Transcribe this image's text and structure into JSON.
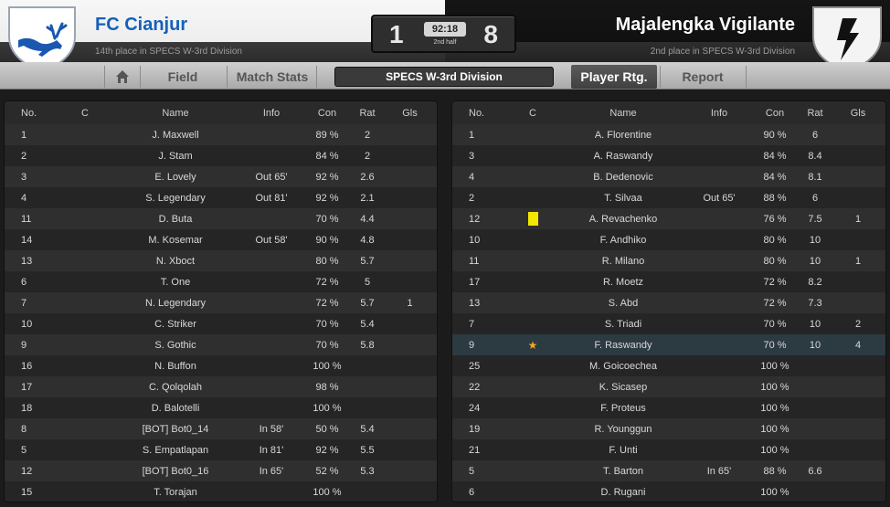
{
  "header": {
    "home": {
      "name": "FC Cianjur",
      "subtitle": "14th place in SPECS W-3rd Division",
      "score": "1"
    },
    "away": {
      "name": "Majalengka Vigilante",
      "subtitle": "2nd place in SPECS W-3rd Division",
      "score": "8"
    },
    "clock": "92:18",
    "half": "2nd half"
  },
  "nav": {
    "home_icon": "home-icon",
    "field": "Field",
    "match_stats": "Match Stats",
    "division": "SPECS W-3rd Division",
    "player_rtg": "Player Rtg.",
    "report": "Report"
  },
  "columns": [
    "No.",
    "C",
    "Name",
    "Info",
    "Con",
    "Rat",
    "Gls"
  ],
  "colors": {
    "home_accent": "#1560b8",
    "yellow_card": "#f3e600",
    "star": "#f5a623"
  },
  "home_players": [
    {
      "no": "1",
      "c": "",
      "name": "J. Maxwell",
      "info": "",
      "con": "89 %",
      "rat": "2",
      "gls": ""
    },
    {
      "no": "2",
      "c": "",
      "name": "J. Stam",
      "info": "",
      "con": "84 %",
      "rat": "2",
      "gls": ""
    },
    {
      "no": "3",
      "c": "",
      "name": "E. Lovely",
      "info": "Out 65'",
      "con": "92 %",
      "rat": "2.6",
      "gls": ""
    },
    {
      "no": "4",
      "c": "",
      "name": "S. Legendary",
      "info": "Out 81'",
      "con": "92 %",
      "rat": "2.1",
      "gls": ""
    },
    {
      "no": "11",
      "c": "",
      "name": "D. Buta",
      "info": "",
      "con": "70 %",
      "rat": "4.4",
      "gls": ""
    },
    {
      "no": "14",
      "c": "",
      "name": "M. Kosemar",
      "info": "Out 58'",
      "con": "90 %",
      "rat": "4.8",
      "gls": ""
    },
    {
      "no": "13",
      "c": "",
      "name": "N. Xboct",
      "info": "",
      "con": "80 %",
      "rat": "5.7",
      "gls": ""
    },
    {
      "no": "6",
      "c": "",
      "name": "T. One",
      "info": "",
      "con": "72 %",
      "rat": "5",
      "gls": ""
    },
    {
      "no": "7",
      "c": "",
      "name": "N. Legendary",
      "info": "",
      "con": "72 %",
      "rat": "5.7",
      "gls": "1"
    },
    {
      "no": "10",
      "c": "",
      "name": "C. Striker",
      "info": "",
      "con": "70 %",
      "rat": "5.4",
      "gls": ""
    },
    {
      "no": "9",
      "c": "",
      "name": "S. Gothic",
      "info": "",
      "con": "70 %",
      "rat": "5.8",
      "gls": ""
    },
    {
      "no": "16",
      "c": "",
      "name": "N. Buffon",
      "info": "",
      "con": "100 %",
      "rat": "",
      "gls": ""
    },
    {
      "no": "17",
      "c": "",
      "name": "C. Qolqolah",
      "info": "",
      "con": "98 %",
      "rat": "",
      "gls": ""
    },
    {
      "no": "18",
      "c": "",
      "name": "D. Balotelli",
      "info": "",
      "con": "100 %",
      "rat": "",
      "gls": ""
    },
    {
      "no": "8",
      "c": "",
      "name": "[BOT] Bot0_14",
      "info": "In 58'",
      "con": "50 %",
      "rat": "5.4",
      "gls": ""
    },
    {
      "no": "5",
      "c": "",
      "name": "S. Empatlapan",
      "info": "In 81'",
      "con": "92 %",
      "rat": "5.5",
      "gls": ""
    },
    {
      "no": "12",
      "c": "",
      "name": "[BOT] Bot0_16",
      "info": "In 65'",
      "con": "52 %",
      "rat": "5.3",
      "gls": ""
    },
    {
      "no": "15",
      "c": "",
      "name": "T. Torajan",
      "info": "",
      "con": "100 %",
      "rat": "",
      "gls": ""
    }
  ],
  "away_players": [
    {
      "no": "1",
      "c": "",
      "name": "A. Florentine",
      "info": "",
      "con": "90 %",
      "rat": "6",
      "gls": ""
    },
    {
      "no": "3",
      "c": "",
      "name": "A. Raswandy",
      "info": "",
      "con": "84 %",
      "rat": "8.4",
      "gls": ""
    },
    {
      "no": "4",
      "c": "",
      "name": "B. Dedenovic",
      "info": "",
      "con": "84 %",
      "rat": "8.1",
      "gls": ""
    },
    {
      "no": "2",
      "c": "",
      "name": "T. Silvaa",
      "info": "Out 65'",
      "con": "88 %",
      "rat": "6",
      "gls": ""
    },
    {
      "no": "12",
      "c": "yellow-card",
      "name": "A. Revachenko",
      "info": "",
      "con": "76 %",
      "rat": "7.5",
      "gls": "1"
    },
    {
      "no": "10",
      "c": "",
      "name": "F. Andhiko",
      "info": "",
      "con": "80 %",
      "rat": "10",
      "gls": ""
    },
    {
      "no": "11",
      "c": "",
      "name": "R. Milano",
      "info": "",
      "con": "80 %",
      "rat": "10",
      "gls": "1"
    },
    {
      "no": "17",
      "c": "",
      "name": "R. Moetz",
      "info": "",
      "con": "72 %",
      "rat": "8.2",
      "gls": ""
    },
    {
      "no": "13",
      "c": "",
      "name": "S. Abd",
      "info": "",
      "con": "72 %",
      "rat": "7.3",
      "gls": ""
    },
    {
      "no": "7",
      "c": "",
      "name": "S. Triadi",
      "info": "",
      "con": "70 %",
      "rat": "10",
      "gls": "2"
    },
    {
      "no": "9",
      "c": "star",
      "name": "F. Raswandy",
      "info": "",
      "con": "70 %",
      "rat": "10",
      "gls": "4",
      "highlight": true
    },
    {
      "no": "25",
      "c": "",
      "name": "M. Goicoechea",
      "info": "",
      "con": "100 %",
      "rat": "",
      "gls": ""
    },
    {
      "no": "22",
      "c": "",
      "name": "K. Sicasep",
      "info": "",
      "con": "100 %",
      "rat": "",
      "gls": ""
    },
    {
      "no": "24",
      "c": "",
      "name": "F. Proteus",
      "info": "",
      "con": "100 %",
      "rat": "",
      "gls": ""
    },
    {
      "no": "19",
      "c": "",
      "name": "R. Younggun",
      "info": "",
      "con": "100 %",
      "rat": "",
      "gls": ""
    },
    {
      "no": "21",
      "c": "",
      "name": "F. Unti",
      "info": "",
      "con": "100 %",
      "rat": "",
      "gls": ""
    },
    {
      "no": "5",
      "c": "",
      "name": "T. Barton",
      "info": "In 65'",
      "con": "88 %",
      "rat": "6.6",
      "gls": ""
    },
    {
      "no": "6",
      "c": "",
      "name": "D. Rugani",
      "info": "",
      "con": "100 %",
      "rat": "",
      "gls": ""
    }
  ]
}
